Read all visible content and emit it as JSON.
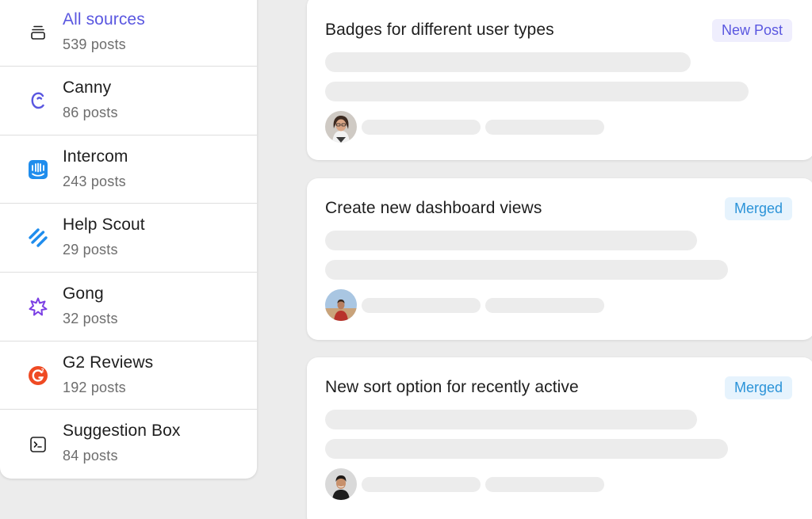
{
  "sources": [
    {
      "name": "All sources",
      "count": "539 posts",
      "icon": "stack-icon",
      "active": true
    },
    {
      "name": "Canny",
      "count": "86 posts",
      "icon": "canny-logo-icon"
    },
    {
      "name": "Intercom",
      "count": "243 posts",
      "icon": "intercom-logo-icon"
    },
    {
      "name": "Help Scout",
      "count": "29 posts",
      "icon": "helpscout-logo-icon"
    },
    {
      "name": "Gong",
      "count": "32 posts",
      "icon": "gong-logo-icon"
    },
    {
      "name": "G2 Reviews",
      "count": "192 posts",
      "icon": "g2-logo-icon"
    },
    {
      "name": "Suggestion Box",
      "count": "84 posts",
      "icon": "terminal-icon"
    }
  ],
  "posts": [
    {
      "title": "Badges for different user types",
      "status": "New Post",
      "status_color": "#5a57e0"
    },
    {
      "title": "Create new dashboard views",
      "status": "Merged",
      "status_color": "#2b93d8"
    },
    {
      "title": "New sort option for recently active",
      "status": "Merged",
      "status_color": "#2b93d8"
    }
  ],
  "colors": {
    "accent": "#5a57e0",
    "merged": "#2b93d8",
    "background": "#ececec",
    "skeleton": "#ececec"
  }
}
